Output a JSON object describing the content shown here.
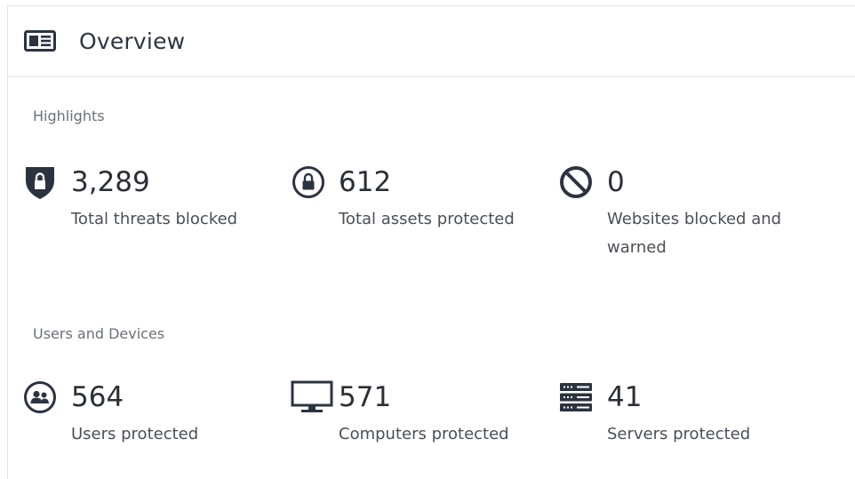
{
  "header": {
    "title": "Overview",
    "icon": "overview-card-icon"
  },
  "highlights": {
    "label": "Highlights",
    "items": [
      {
        "value": "3,289",
        "label": "Total threats blocked",
        "icon": "shield-lock-icon"
      },
      {
        "value": "612",
        "label": "Total assets protected",
        "icon": "circle-lock-icon"
      },
      {
        "value": "0",
        "label": "Websites blocked and warned",
        "icon": "blocked-icon"
      }
    ]
  },
  "users_devices": {
    "label": "Users and Devices",
    "items": [
      {
        "value": "564",
        "label": "Users protected",
        "icon": "users-icon"
      },
      {
        "value": "571",
        "label": "Computers protected",
        "icon": "monitor-icon"
      },
      {
        "value": "41",
        "label": "Servers protected",
        "icon": "server-icon"
      }
    ]
  },
  "colors": {
    "icon": "#2c3340",
    "text": "#2b2f36",
    "muted": "#6b707a"
  }
}
